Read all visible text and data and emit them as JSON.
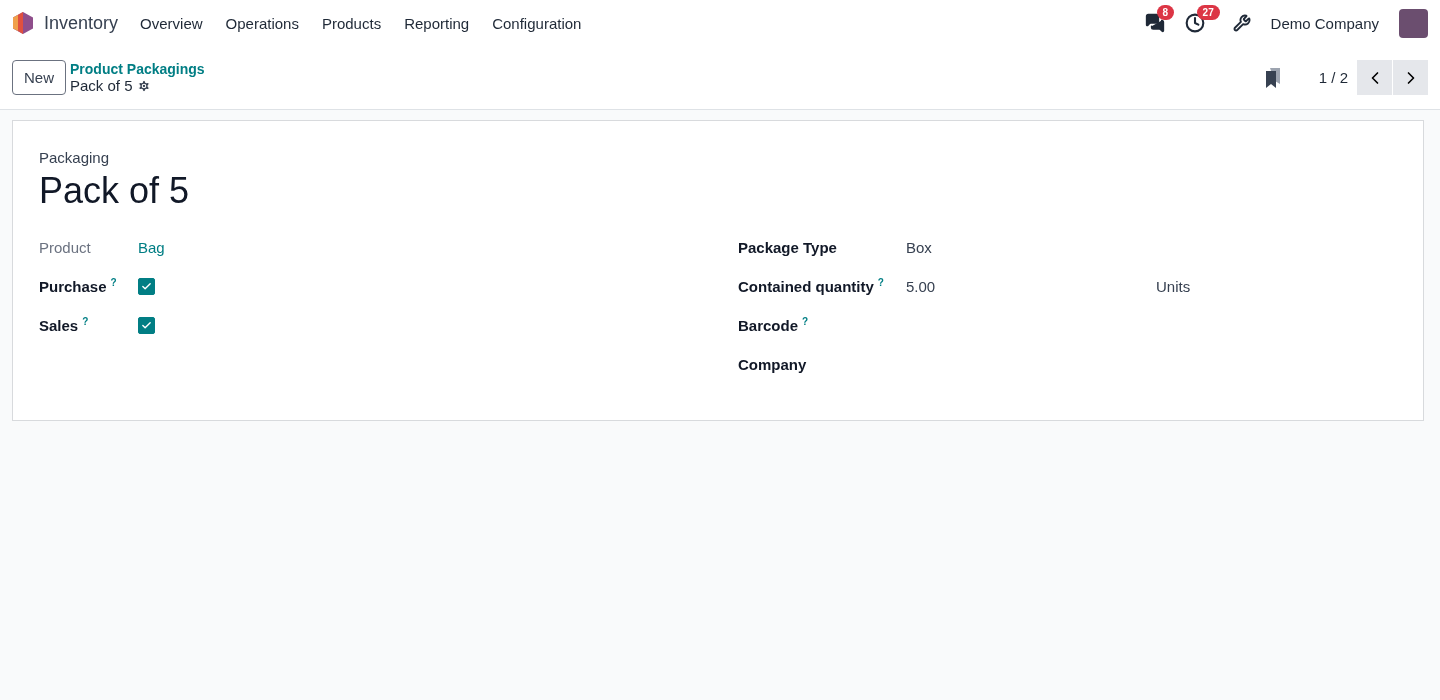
{
  "navbar": {
    "app_name": "Inventory",
    "menu": [
      "Overview",
      "Operations",
      "Products",
      "Reporting",
      "Configuration"
    ],
    "messages_count": "8",
    "activities_count": "27",
    "company": "Demo Company"
  },
  "control_panel": {
    "new_button": "New",
    "breadcrumb": "Product Packagings",
    "record_name": "Pack of 5",
    "pager": "1 / 2"
  },
  "form": {
    "subtitle": "Packaging",
    "title": "Pack of 5",
    "left_fields": [
      {
        "kind": "link",
        "label": "Product",
        "value": "Bag"
      },
      {
        "kind": "checkbox",
        "label": "Purchase",
        "help": "?",
        "checked": true
      },
      {
        "kind": "checkbox",
        "label": "Sales",
        "help": "?",
        "checked": true
      }
    ],
    "right_fields": [
      {
        "kind": "text",
        "label": "Package Type",
        "value": "Box"
      },
      {
        "kind": "quantity",
        "label": "Contained quantity",
        "help": "?",
        "value": "5.00",
        "unit": "Units"
      },
      {
        "kind": "text",
        "label": "Barcode",
        "help": "?"
      },
      {
        "kind": "text",
        "label": "Company"
      }
    ]
  }
}
